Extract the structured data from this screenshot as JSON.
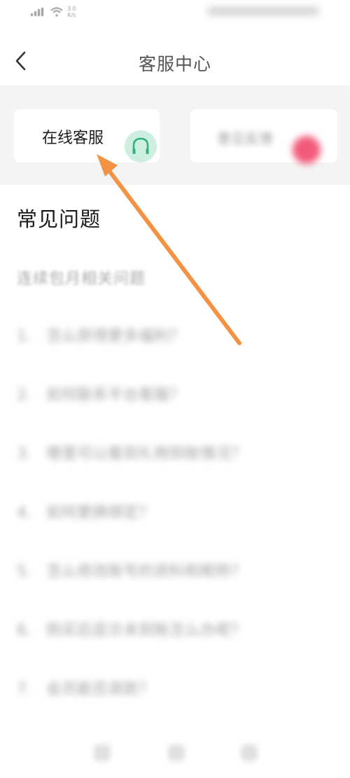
{
  "status_bar": {
    "net_speed": "3.0\nK/s"
  },
  "nav": {
    "title": "客服中心"
  },
  "service_cards": {
    "online_label": "在线客服",
    "feedback_label": "意见反馈"
  },
  "faq": {
    "title": "常见问题",
    "subtitle": "连续包月相关问题",
    "items": [
      {
        "num": "1.",
        "text": "怎么获得更多福利？"
      },
      {
        "num": "2.",
        "text": "如何联系平台客服？"
      },
      {
        "num": "3.",
        "text": "哪里可以看到礼物到账情况？"
      },
      {
        "num": "4.",
        "text": "如何更换绑定？"
      },
      {
        "num": "5.",
        "text": "怎么修改账号的资料和昵称？"
      },
      {
        "num": "6.",
        "text": "购买后显示未到账怎么办呢？"
      },
      {
        "num": "7.",
        "text": "会员能否退款？"
      }
    ]
  },
  "colors": {
    "accent_green": "#2db37f",
    "arrow_orange": "#f29242",
    "band_bg": "#f4f4f4"
  },
  "icons": {
    "back": "chevron-left-icon",
    "headset": "headset-icon",
    "signal": "signal-icon",
    "wifi": "wifi-icon"
  }
}
